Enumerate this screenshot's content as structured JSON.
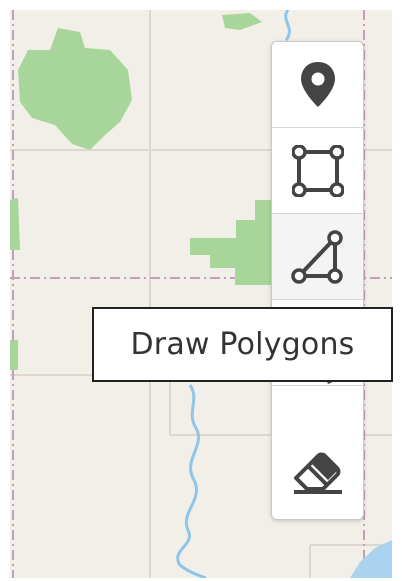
{
  "map": {
    "colors": {
      "land": "#f2efe9",
      "park": "#a8d59a",
      "river": "#8fc5e8",
      "water": "#a9d3ee",
      "road": "#dcd7cf",
      "boundary": "#c49fb8"
    }
  },
  "toolbar": {
    "tools": [
      {
        "name": "marker-tool",
        "icon": "map-pin-icon"
      },
      {
        "name": "rectangle-tool",
        "icon": "rectangle-icon"
      },
      {
        "name": "polygon-tool",
        "icon": "polygon-icon"
      },
      {
        "name": "select-tool",
        "icon": "cursor-icon"
      },
      {
        "name": "erase-tool",
        "icon": "eraser-icon"
      }
    ],
    "tooltip": "Draw Polygons"
  }
}
